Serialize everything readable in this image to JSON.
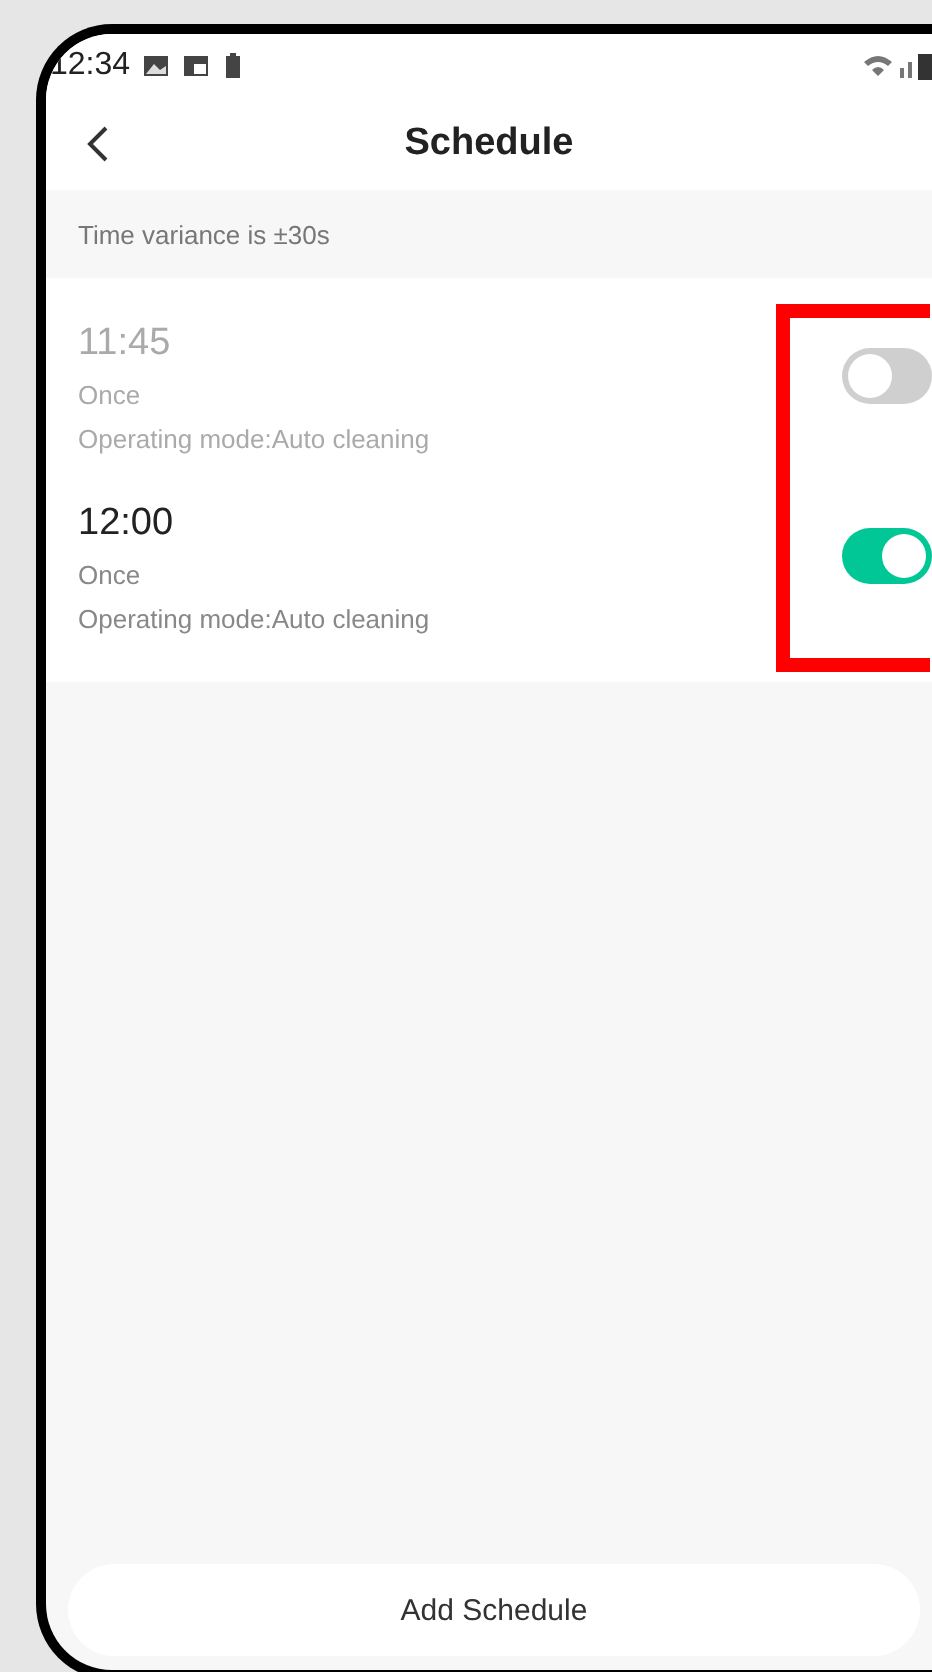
{
  "status_bar": {
    "time": "12:34"
  },
  "header": {
    "title": "Schedule"
  },
  "notice": "Time variance is ±30s",
  "schedules": [
    {
      "time": "11:45",
      "repeat": "Once",
      "mode": "Operating mode:Auto cleaning",
      "on": false
    },
    {
      "time": "12:00",
      "repeat": "Once",
      "mode": "Operating mode:Auto cleaning",
      "on": true
    }
  ],
  "add_button": "Add Schedule"
}
